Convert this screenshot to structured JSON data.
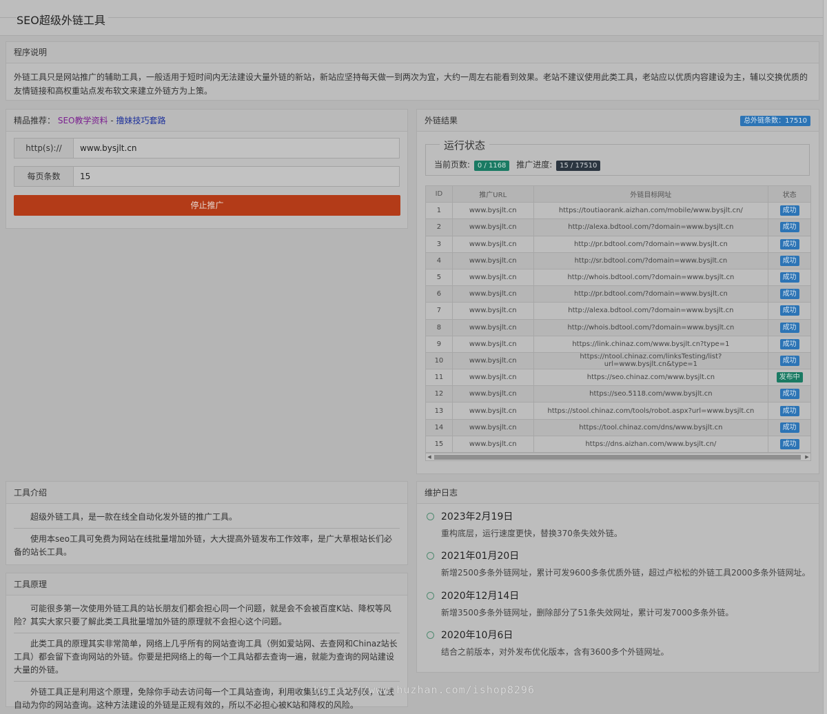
{
  "header": {
    "title": "SEO超级外链工具"
  },
  "intro": {
    "heading": "程序说明",
    "text": "外链工具只是网站推广的辅助工具，一般适用于短时间内无法建设大量外链的新站，新站应坚持每天做一到两次为宜，大约一周左右能看到效果。老站不建议使用此类工具，老站应以优质内容建设为主，辅以交换优质的友情链接和高权重站点发布软文来建立外链方为上策。"
  },
  "control": {
    "rec_label": "精品推荐：",
    "rec_link1": "SEO教学资料",
    "rec_sep": "-",
    "rec_link2": "撸妹技巧套路",
    "url_label": "http(s)://",
    "url_value": "www.bysjlt.cn",
    "per_page_label": "每页条数",
    "per_page_value": "15",
    "stop_label": "停止推广"
  },
  "results": {
    "heading": "外链结果",
    "total_badge": "总外链条数：17510",
    "run_legend": "运行状态",
    "current_page_label": "当前页数:",
    "current_page_value": "0 / 1168",
    "progress_label": "推广进度:",
    "progress_value": "15 / 17510",
    "columns": [
      "ID",
      "推广URL",
      "外链目标网址",
      "状态"
    ],
    "rows": [
      {
        "id": "1",
        "url": "www.bysjlt.cn",
        "target": "https://toutiaorank.aizhan.com/mobile/www.bysjlt.cn/",
        "status": "成功"
      },
      {
        "id": "2",
        "url": "www.bysjlt.cn",
        "target": "http://alexa.bdtool.com/?domain=www.bysjlt.cn",
        "status": "成功"
      },
      {
        "id": "3",
        "url": "www.bysjlt.cn",
        "target": "http://pr.bdtool.com/?domain=www.bysjlt.cn",
        "status": "成功"
      },
      {
        "id": "4",
        "url": "www.bysjlt.cn",
        "target": "http://sr.bdtool.com/?domain=www.bysjlt.cn",
        "status": "成功"
      },
      {
        "id": "5",
        "url": "www.bysjlt.cn",
        "target": "http://whois.bdtool.com/?domain=www.bysjlt.cn",
        "status": "成功"
      },
      {
        "id": "6",
        "url": "www.bysjlt.cn",
        "target": "http://pr.bdtool.com/?domain=www.bysjlt.cn",
        "status": "成功"
      },
      {
        "id": "7",
        "url": "www.bysjlt.cn",
        "target": "http://alexa.bdtool.com/?domain=www.bysjlt.cn",
        "status": "成功"
      },
      {
        "id": "8",
        "url": "www.bysjlt.cn",
        "target": "http://whois.bdtool.com/?domain=www.bysjlt.cn",
        "status": "成功"
      },
      {
        "id": "9",
        "url": "www.bysjlt.cn",
        "target": "https://link.chinaz.com/www.bysjlt.cn?type=1",
        "status": "成功"
      },
      {
        "id": "10",
        "url": "www.bysjlt.cn",
        "target": "https://ntool.chinaz.com/linksTesting/list?url=www.bysjlt.cn&type=1",
        "status": "成功"
      },
      {
        "id": "11",
        "url": "www.bysjlt.cn",
        "target": "https://seo.chinaz.com/www.bysjlt.cn",
        "status": "发布中"
      },
      {
        "id": "12",
        "url": "www.bysjlt.cn",
        "target": "https://seo.5118.com/www.bysjlt.cn",
        "status": "成功"
      },
      {
        "id": "13",
        "url": "www.bysjlt.cn",
        "target": "https://stool.chinaz.com/tools/robot.aspx?url=www.bysjlt.cn",
        "status": "成功"
      },
      {
        "id": "14",
        "url": "www.bysjlt.cn",
        "target": "https://tool.chinaz.com/dns/www.bysjlt.cn",
        "status": "成功"
      },
      {
        "id": "15",
        "url": "www.bysjlt.cn",
        "target": "https://dns.aizhan.com/www.bysjlt.cn/",
        "status": "成功"
      }
    ]
  },
  "tool_intro": {
    "heading": "工具介绍",
    "paragraphs": [
      "超级外链工具，是一款在线全自动化发外链的推广工具。",
      "使用本seo工具可免费为网站在线批量增加外链，大大提高外链发布工作效率，是广大草根站长们必备的站长工具。"
    ]
  },
  "principle": {
    "heading": "工具原理",
    "paragraphs": [
      "可能很多第一次使用外链工具的站长朋友们都会担心同一个问题，就是会不会被百度K站、降权等风险？其实大家只要了解此类工具批量增加外链的原理就不会担心这个问题。",
      "此类工具的原理其实非常简单，网络上几乎所有的网站查询工具（例如爱站网、去查网和Chinaz站长工具）都会留下查询网站的外链。你要是把网络上的每一个工具站都去查询一遍，就能为查询的网站建设大量的外链。",
      "外链工具正是利用这个原理，免除你手动去访问每一个工具站查询，利用收集到的工具站列表，在线自动为你的网站查询。这种方法建设的外链是正规有效的，所以不必担心被K站和降权的风险。"
    ]
  },
  "log": {
    "heading": "维护日志",
    "items": [
      {
        "date": "2023年2月19日",
        "desc": "重构底层，运行速度更快，替换370条失效外链。"
      },
      {
        "date": "2021年01月20日",
        "desc": "新增2500多条外链网址，累计可发9600多条优质外链，超过卢松松的外链工具2000多条外链网址。"
      },
      {
        "date": "2020年12月14日",
        "desc": "新增3500多条外链网址，删除部分了51条失效网址，累计可发7000多条外链。"
      },
      {
        "date": "2020年10月6日",
        "desc": "结合之前版本，对外发布优化版本，含有3600多个外链网址。"
      }
    ]
  },
  "watermark": "https://www.huzhan.com/ishop8296"
}
